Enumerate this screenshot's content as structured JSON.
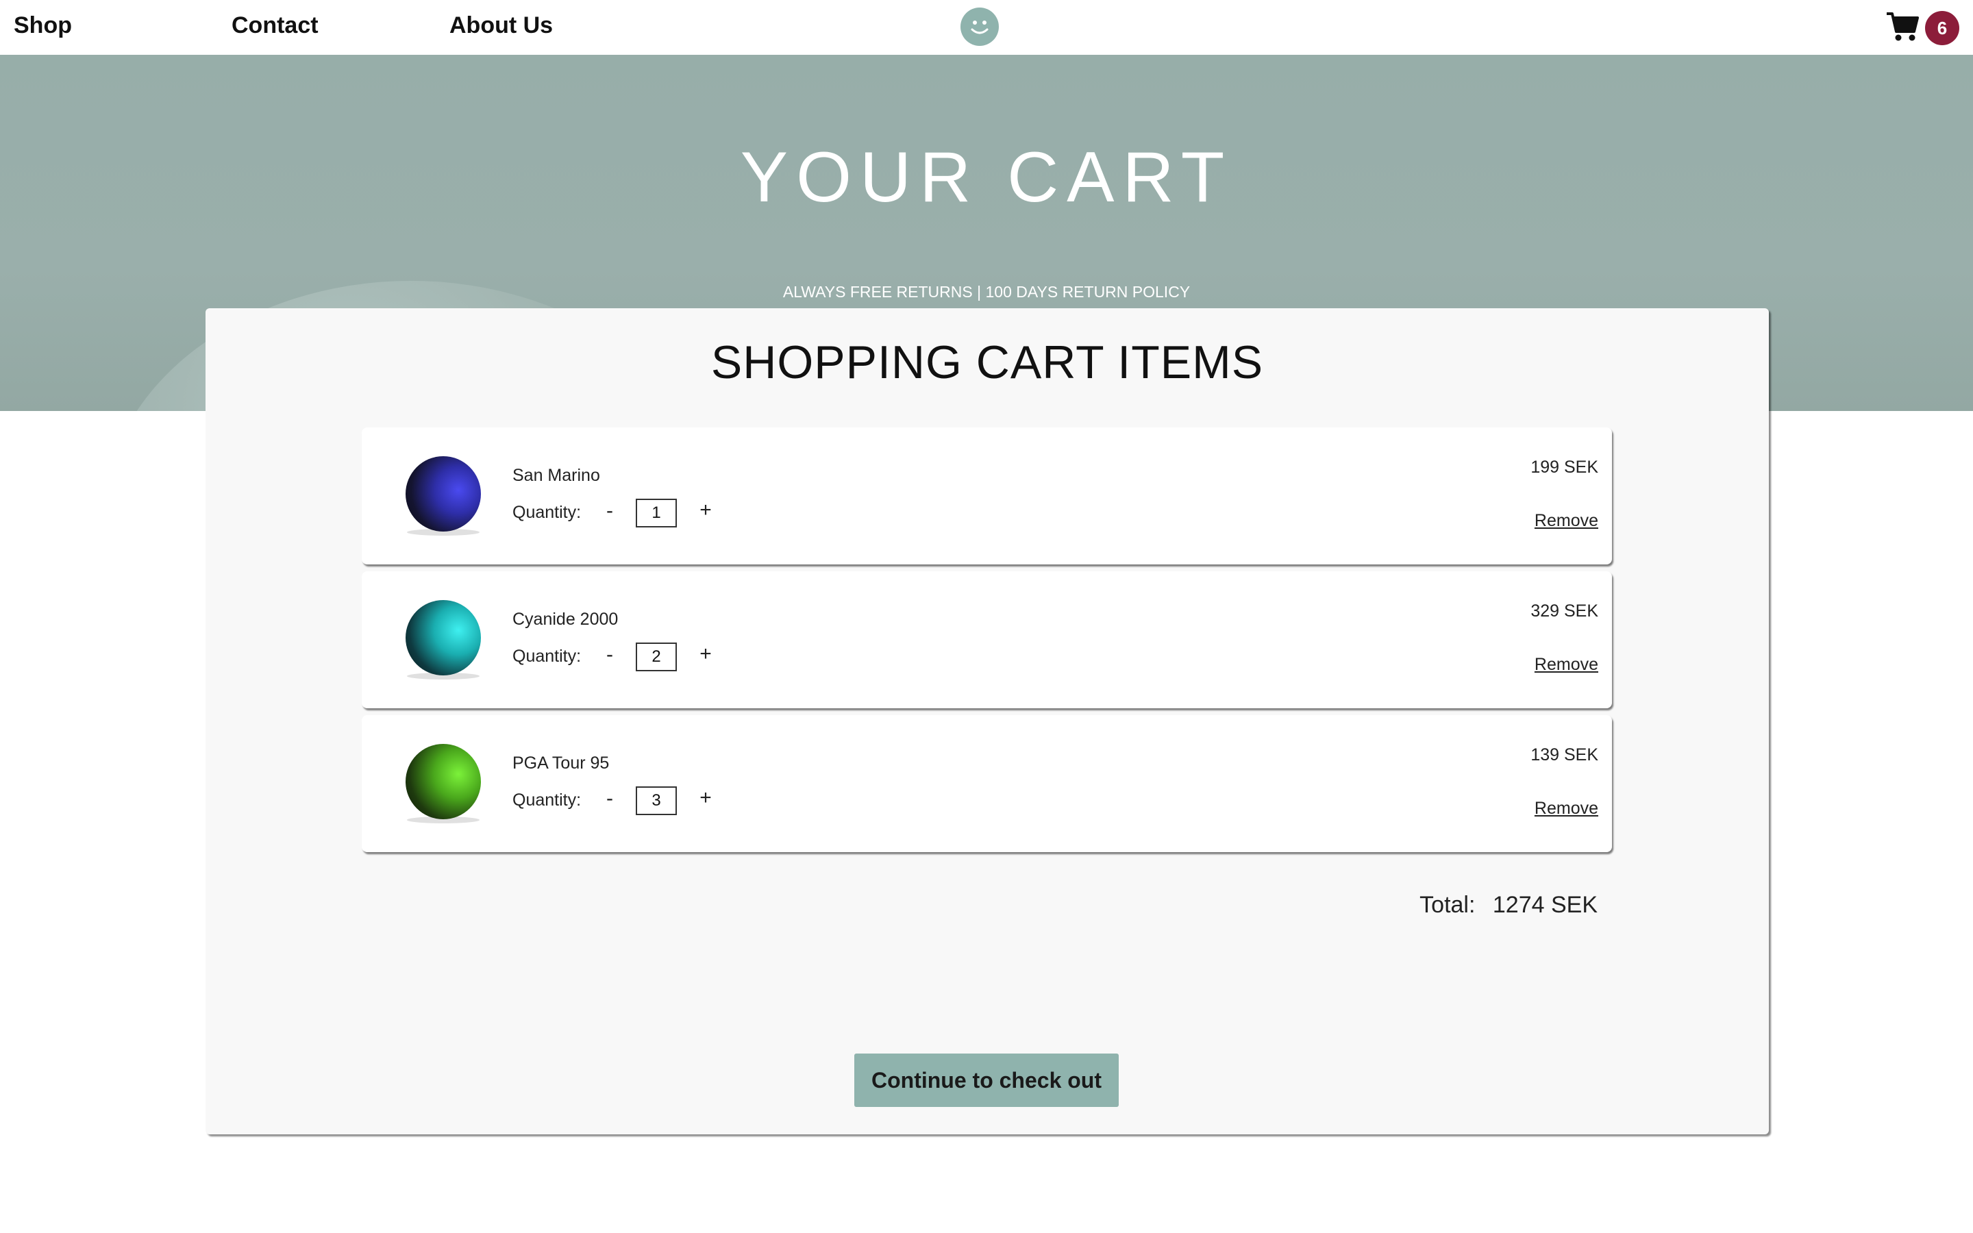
{
  "nav": {
    "links": [
      "Shop",
      "Contact",
      "About Us"
    ],
    "cart_count": "6",
    "logo_icon": "smiley-face-icon",
    "cart_icon": "shopping-cart-icon"
  },
  "hero": {
    "title": "YOUR CART",
    "subtitle": "ALWAYS FREE RETURNS | 100 DAYS RETURN POLICY"
  },
  "cart": {
    "heading": "SHOPPING CART ITEMS",
    "quantity_label": "Quantity:",
    "minus_label": "-",
    "plus_label": "+",
    "remove_label": "Remove",
    "items": [
      {
        "name": "San Marino",
        "quantity": "1",
        "price": "199 SEK",
        "color": "#3a3ad6"
      },
      {
        "name": "Cyanide 2000",
        "quantity": "2",
        "price": "329 SEK",
        "color": "#1fd3d3"
      },
      {
        "name": "PGA Tour 95",
        "quantity": "3",
        "price": "139 SEK",
        "color": "#5fd41f"
      }
    ],
    "total_label": "Total:",
    "total_value": "1274 SEK",
    "checkout_label": "Continue to check out"
  },
  "colors": {
    "accent": "#8fb3ad",
    "badge": "#8c1d3a",
    "hero_bg": "#97aea9"
  }
}
